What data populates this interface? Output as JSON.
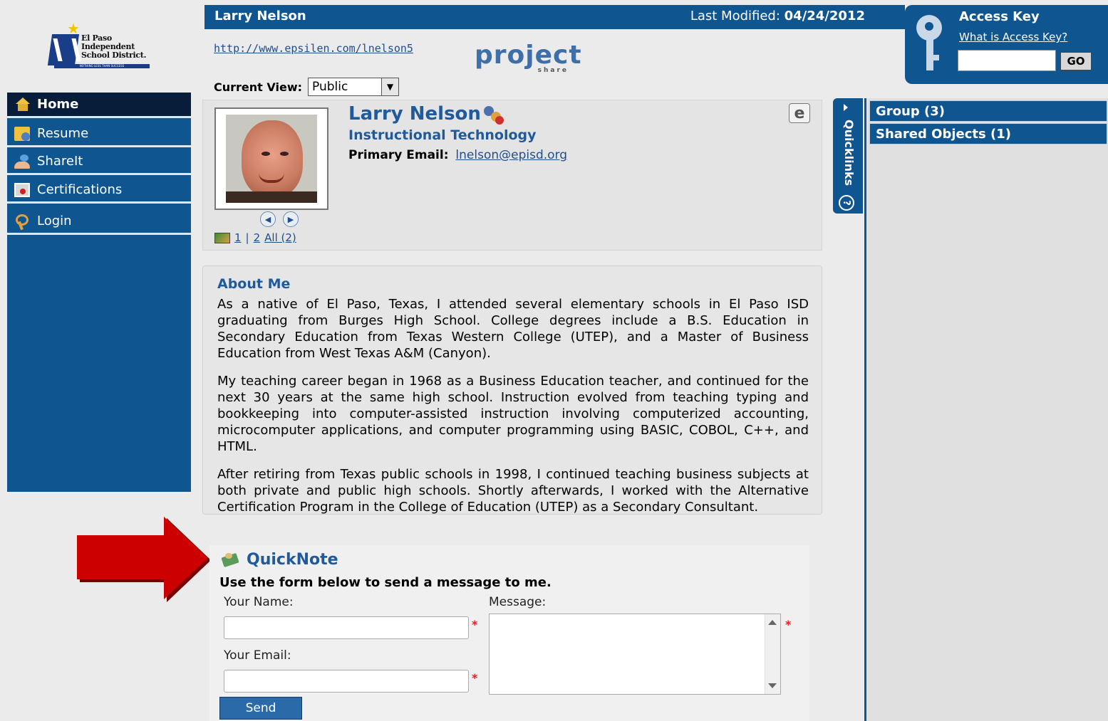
{
  "logo": {
    "lines": [
      "El Paso",
      "Independent",
      "School District."
    ],
    "tagline": "NOTHING LESS THAN SUCCESS"
  },
  "nav": {
    "items": [
      {
        "label": "Home",
        "icon": "home-icon",
        "active": true
      },
      {
        "label": "Resume",
        "icon": "resume-icon"
      },
      {
        "label": "ShareIt",
        "icon": "share-icon"
      },
      {
        "label": "Certifications",
        "icon": "certificate-icon"
      },
      {
        "label": "Login",
        "icon": "key-icon"
      }
    ]
  },
  "header": {
    "name": "Larry Nelson",
    "modified_label": "Last Modified:",
    "modified_date": "04/24/2012",
    "url": "http://www.epsilen.com/lnelson5",
    "brand_word": "project",
    "brand_sub": "share",
    "view_label": "Current View:",
    "view_value": "Public"
  },
  "access": {
    "title": "Access Key",
    "what_link": "What is Access Key?",
    "go_label": "GO"
  },
  "profile": {
    "name": "Larry Nelson",
    "department": "Instructional Technology",
    "email_label": "Primary Email:",
    "email": "lnelson@episd.org",
    "pager_sep": "|",
    "pages": [
      "1",
      "2"
    ],
    "all_label": "All (2)",
    "e_button": "e"
  },
  "quicklinks": {
    "label": "Quicklinks",
    "help": "?"
  },
  "right": {
    "group_label": "Group (3)",
    "shared_label": "Shared Objects (1)"
  },
  "about": {
    "title": "About Me",
    "paragraphs": [
      "As a native of El Paso, Texas, I attended several elementary schools in El Paso ISD graduating from Burges High School.  College degrees include a B.S. Education in Secondary Education from Texas Western College (UTEP), and a Master of Business Education from West Texas A&M (Canyon).",
      "My teaching career began in 1968 as a Business Education teacher, and continued for the next 30 years at the same high school. Instruction evolved from teaching typing and bookkeeping into computer-assisted instruction involving computerized accounting, microcomputer applications, and computer programming using BASIC, COBOL, C++, and HTML.",
      "After retiring from Texas public schools in 1998, I continued teaching business subjects at both private and public high schools.  Shortly afterwards, I worked with the Alternative Certification Program in the College of Education (UTEP) as a Secondary Consultant."
    ]
  },
  "quicknote": {
    "title": "QuickNote",
    "description": "Use the form below to send a message to me.",
    "name_label": "Your Name:",
    "email_label": "Your Email:",
    "message_label": "Message:",
    "required_mark": "*",
    "send_label": "Send",
    "name_value": "",
    "email_value": "",
    "message_value": ""
  },
  "colors": {
    "brand_blue": "#0f5590",
    "nav_active": "#071d3a",
    "link_blue": "#1f5a9c",
    "arrow_red": "#cc0000",
    "required_red": "#e02020"
  }
}
